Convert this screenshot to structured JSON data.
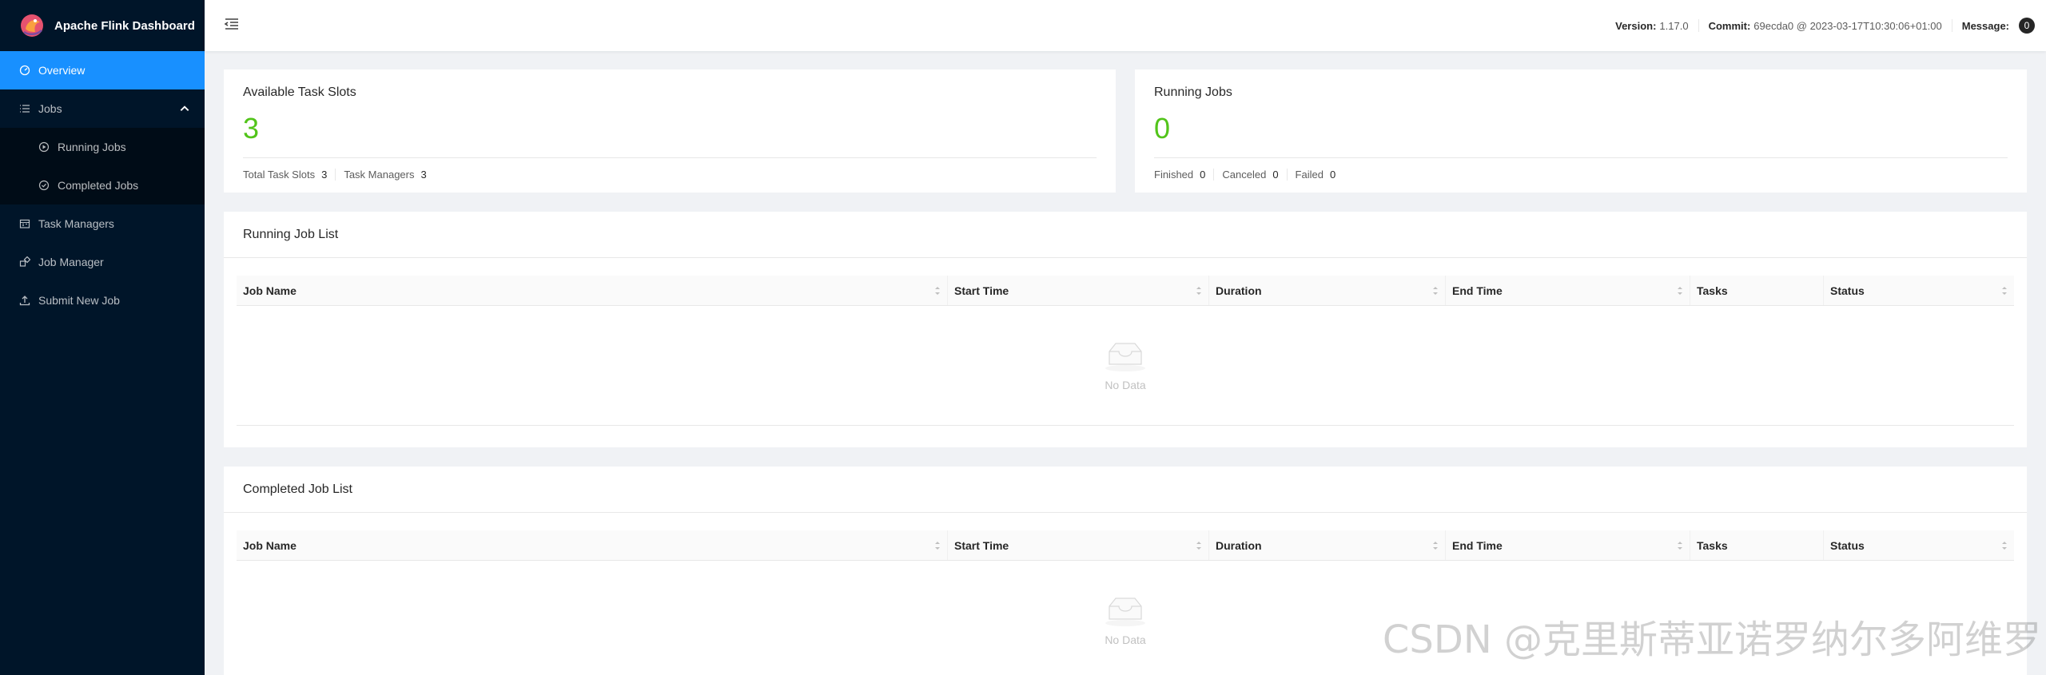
{
  "brand": {
    "title": "Apache Flink Dashboard"
  },
  "sidebar": {
    "items": [
      {
        "label": "Overview",
        "icon": "dashboard-icon"
      },
      {
        "label": "Jobs",
        "icon": "unordered-list-icon"
      },
      {
        "label": "Running Jobs",
        "icon": "play-circle-icon"
      },
      {
        "label": "Completed Jobs",
        "icon": "check-circle-icon"
      },
      {
        "label": "Task Managers",
        "icon": "schedule-icon"
      },
      {
        "label": "Job Manager",
        "icon": "build-icon"
      },
      {
        "label": "Submit New Job",
        "icon": "upload-icon"
      }
    ]
  },
  "header": {
    "version_label": "Version:",
    "version_value": "1.17.0",
    "commit_label": "Commit:",
    "commit_value": "69ecda0 @ 2023-03-17T10:30:06+01:00",
    "message_label": "Message:",
    "message_count": "0"
  },
  "slots_card": {
    "title": "Available Task Slots",
    "value": "3",
    "footer": [
      {
        "label": "Total Task Slots",
        "value": "3"
      },
      {
        "label": "Task Managers",
        "value": "3"
      }
    ]
  },
  "jobs_card": {
    "title": "Running Jobs",
    "value": "0",
    "footer": [
      {
        "label": "Finished",
        "value": "0"
      },
      {
        "label": "Canceled",
        "value": "0"
      },
      {
        "label": "Failed",
        "value": "0"
      }
    ]
  },
  "running_list": {
    "title": "Running Job List",
    "columns": [
      "Job Name",
      "Start Time",
      "Duration",
      "End Time",
      "Tasks",
      "Status"
    ],
    "empty_text": "No Data"
  },
  "completed_list": {
    "title": "Completed Job List",
    "columns": [
      "Job Name",
      "Start Time",
      "Duration",
      "End Time",
      "Tasks",
      "Status"
    ],
    "empty_text": "No Data"
  },
  "watermark": "CSDN @克里斯蒂亚诺罗纳尔多阿维罗",
  "colors": {
    "sidebar": "#001529",
    "active": "#1890ff",
    "stat_green": "#52c41a"
  }
}
